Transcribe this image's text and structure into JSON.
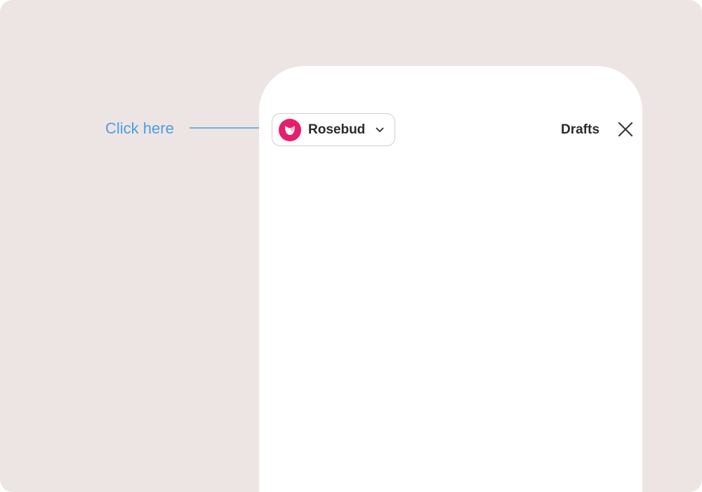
{
  "callout": {
    "label": "Click here",
    "color": "#4a9ee0"
  },
  "header": {
    "account": {
      "name": "Rosebud",
      "avatar_icon": "rosebud-logo-icon",
      "avatar_color": "#e51f6c",
      "dropdown_icon": "chevron-down-icon"
    },
    "drafts_label": "Drafts",
    "close_icon": "close-icon"
  },
  "colors": {
    "background": "#ede5e3",
    "panel": "#ffffff",
    "text": "#2b2b2b"
  }
}
